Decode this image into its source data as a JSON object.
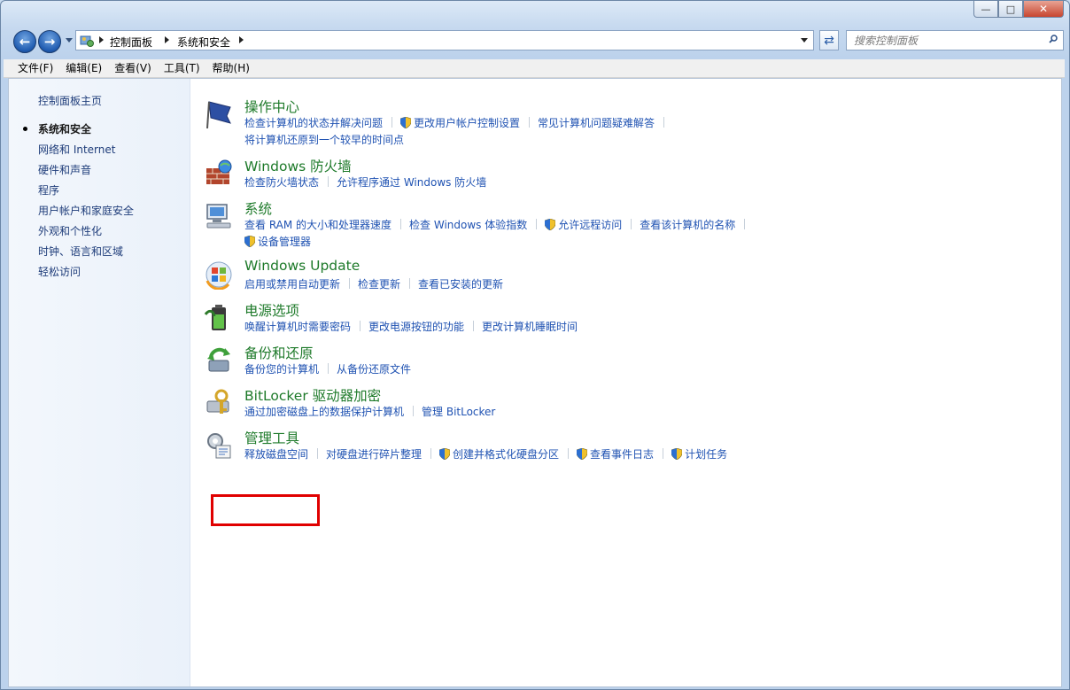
{
  "window": {
    "caption": {
      "minimize": "—",
      "maximize": "□",
      "close": "✕"
    }
  },
  "nav": {
    "back_icon": "back-arrow-icon",
    "forward_icon": "forward-arrow-icon",
    "breadcrumbs": [
      "控制面板",
      "系统和安全"
    ],
    "refresh_icon": "refresh-icon",
    "search_placeholder": "搜索控制面板"
  },
  "menubar": [
    "文件(F)",
    "编辑(E)",
    "查看(V)",
    "工具(T)",
    "帮助(H)"
  ],
  "sidebar": {
    "home": "控制面板主页",
    "items": [
      "系统和安全",
      "网络和 Internet",
      "硬件和声音",
      "程序",
      "用户帐户和家庭安全",
      "外观和个性化",
      "时钟、语言和区域",
      "轻松访问"
    ]
  },
  "categories": [
    {
      "title": "操作中心",
      "icon": "action-center-flag-icon",
      "links": [
        {
          "t": "检查计算机的状态并解决问题"
        },
        {
          "t": "更改用户帐户控制设置",
          "shield": true
        },
        {
          "t": "常见计算机问题疑难解答"
        },
        {
          "t": "将计算机还原到一个较早的时间点"
        }
      ]
    },
    {
      "title": "Windows 防火墙",
      "icon": "firewall-icon",
      "links": [
        {
          "t": "检查防火墙状态"
        },
        {
          "t": "允许程序通过 Windows 防火墙"
        }
      ]
    },
    {
      "title": "系统",
      "icon": "system-computer-icon",
      "links": [
        {
          "t": "查看 RAM 的大小和处理器速度"
        },
        {
          "t": "检查 Windows 体验指数"
        },
        {
          "t": "允许远程访问",
          "shield": true
        },
        {
          "t": "查看该计算机的名称"
        },
        {
          "t": "设备管理器",
          "shield": true
        }
      ]
    },
    {
      "title": "Windows Update",
      "icon": "windows-update-icon",
      "links": [
        {
          "t": "启用或禁用自动更新"
        },
        {
          "t": "检查更新"
        },
        {
          "t": "查看已安装的更新"
        }
      ]
    },
    {
      "title": "电源选项",
      "icon": "power-options-battery-icon",
      "links": [
        {
          "t": "唤醒计算机时需要密码"
        },
        {
          "t": "更改电源按钮的功能"
        },
        {
          "t": "更改计算机睡眠时间"
        }
      ]
    },
    {
      "title": "备份和还原",
      "icon": "backup-restore-icon",
      "links": [
        {
          "t": "备份您的计算机"
        },
        {
          "t": "从备份还原文件"
        }
      ]
    },
    {
      "title": "BitLocker 驱动器加密",
      "icon": "bitlocker-key-icon",
      "links": [
        {
          "t": "通过加密磁盘上的数据保护计算机"
        },
        {
          "t": "管理 BitLocker"
        }
      ]
    },
    {
      "title": "管理工具",
      "icon": "admin-tools-icon",
      "links": [
        {
          "t": "释放磁盘空间"
        },
        {
          "t": "对硬盘进行碎片整理"
        },
        {
          "t": "创建并格式化硬盘分区",
          "shield": true
        },
        {
          "t": "查看事件日志",
          "shield": true
        },
        {
          "t": "计划任务",
          "shield": true
        }
      ]
    }
  ],
  "colors": {
    "title_green": "#1e7a2a",
    "link_blue": "#1f52b2",
    "highlight_red": "#e00000"
  }
}
